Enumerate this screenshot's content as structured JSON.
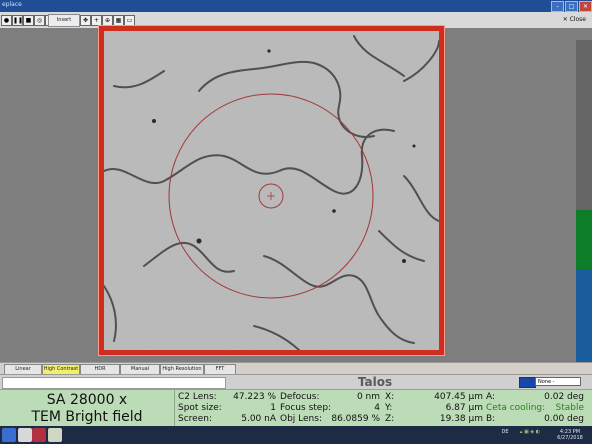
{
  "window": {
    "title": "eplace",
    "controls": [
      "–",
      "□",
      "✕"
    ]
  },
  "toolbar": {
    "insert_screen_label": "Insert Screen",
    "close_label": "Close"
  },
  "view_tabs": [
    {
      "label": "Linear",
      "active": false
    },
    {
      "label": "High Contrast",
      "active": true
    },
    {
      "label": "HDR",
      "active": false
    },
    {
      "label": "Manual",
      "active": false
    },
    {
      "label": "High Resolution",
      "active": false
    },
    {
      "label": "FFT",
      "active": false
    }
  ],
  "header": {
    "instrument": "Talos",
    "dropdown_value": "None -"
  },
  "mode": {
    "magnification": "SA 28000 x",
    "imaging_mode": "TEM Bright field"
  },
  "parameters": {
    "c2_lens_label": "C2 Lens:",
    "c2_lens_value": "47.223 %",
    "spot_size_label": "Spot size:",
    "spot_size_value": "1",
    "screen_label": "Screen:",
    "screen_value": "5.00 nA",
    "defocus_label": "Defocus:",
    "defocus_value": "0 nm",
    "focus_step_label": "Focus step:",
    "focus_step_value": "4",
    "obj_lens_label": "Obj Lens:",
    "obj_lens_value": "86.0859 %",
    "x_label": "X:",
    "x_value": "407.45 µm",
    "y_label": "Y:",
    "y_value": "6.87 µm",
    "z_label": "Z:",
    "z_value": "19.38 µm",
    "a_label": "A:",
    "a_value": "0.02 deg",
    "ceta_label": "Ceta cooling:",
    "ceta_value": "Stable",
    "b_label": "B:",
    "b_value": "0.00 deg"
  },
  "taskbar": {
    "lang": "DE",
    "time": "4:23 PM",
    "date": "6/27/2018"
  },
  "colors": {
    "frame": "#cf2d1e",
    "status_bg": "#bcdcb8",
    "active_tab": "#f4ef6a",
    "ceta_ok": "#2e7d1f"
  }
}
